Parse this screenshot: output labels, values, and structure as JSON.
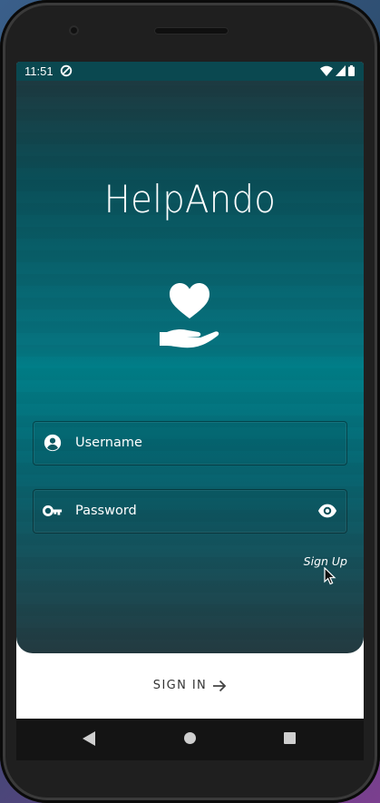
{
  "status_bar": {
    "time": "11:51",
    "icons": [
      "sync-icon",
      "wifi-icon",
      "signal-icon",
      "battery-icon"
    ]
  },
  "app": {
    "title": "HelpAndo",
    "logo_icon": "heart-in-hand-icon"
  },
  "form": {
    "username": {
      "placeholder": "Username",
      "icon": "account-circle-icon"
    },
    "password": {
      "placeholder": "Password",
      "icon": "key-icon",
      "toggle_icon": "eye-icon"
    },
    "signup_link": "Sign Up"
  },
  "footer": {
    "signin_label": "SIGN IN",
    "signin_icon": "arrow-right-icon"
  },
  "nav_bar": {
    "buttons": [
      "back-button",
      "home-button",
      "recents-button"
    ]
  },
  "colors": {
    "teal_dark": "#21363c",
    "teal_mid": "#007f89",
    "status_bar": "#0a4850",
    "white": "#ffffff"
  }
}
